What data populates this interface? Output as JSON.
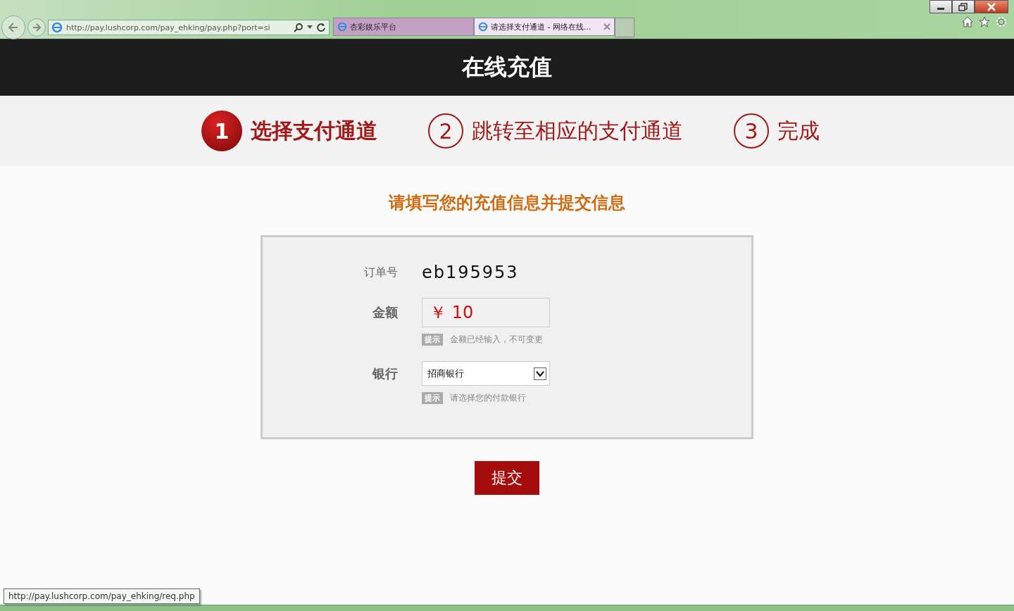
{
  "browser": {
    "address": "http://pay.lushcorp.com/pay_ehking/pay.php?port=si",
    "tabs": [
      {
        "label": "杏彩娱乐平台",
        "selected": false
      },
      {
        "label": "请选择支付通道 - 网络在线...",
        "selected": true
      }
    ]
  },
  "header": {
    "title": "在线充值"
  },
  "steps": [
    {
      "number": "1",
      "label": "选择支付通道",
      "selected": true
    },
    {
      "number": "2",
      "label": "跳转至相应的支付通道",
      "selected": false
    },
    {
      "number": "3",
      "label": "完成",
      "selected": false
    }
  ],
  "form": {
    "heading": "请填写您的充值信息并提交信息",
    "order": {
      "label": "订单号",
      "value": "eb195953"
    },
    "amount": {
      "label": "金额",
      "currency": "￥",
      "value": "10",
      "hint_tag": "提示",
      "hint": "金额已经输入，不可变更"
    },
    "bank": {
      "label": "银行",
      "value": "招商银行",
      "hint_tag": "提示",
      "hint": "请选择您的付款银行"
    },
    "submit": "提交"
  },
  "status_bar": {
    "url": "http://pay.lushcorp.com/pay_ehking/req.php"
  }
}
